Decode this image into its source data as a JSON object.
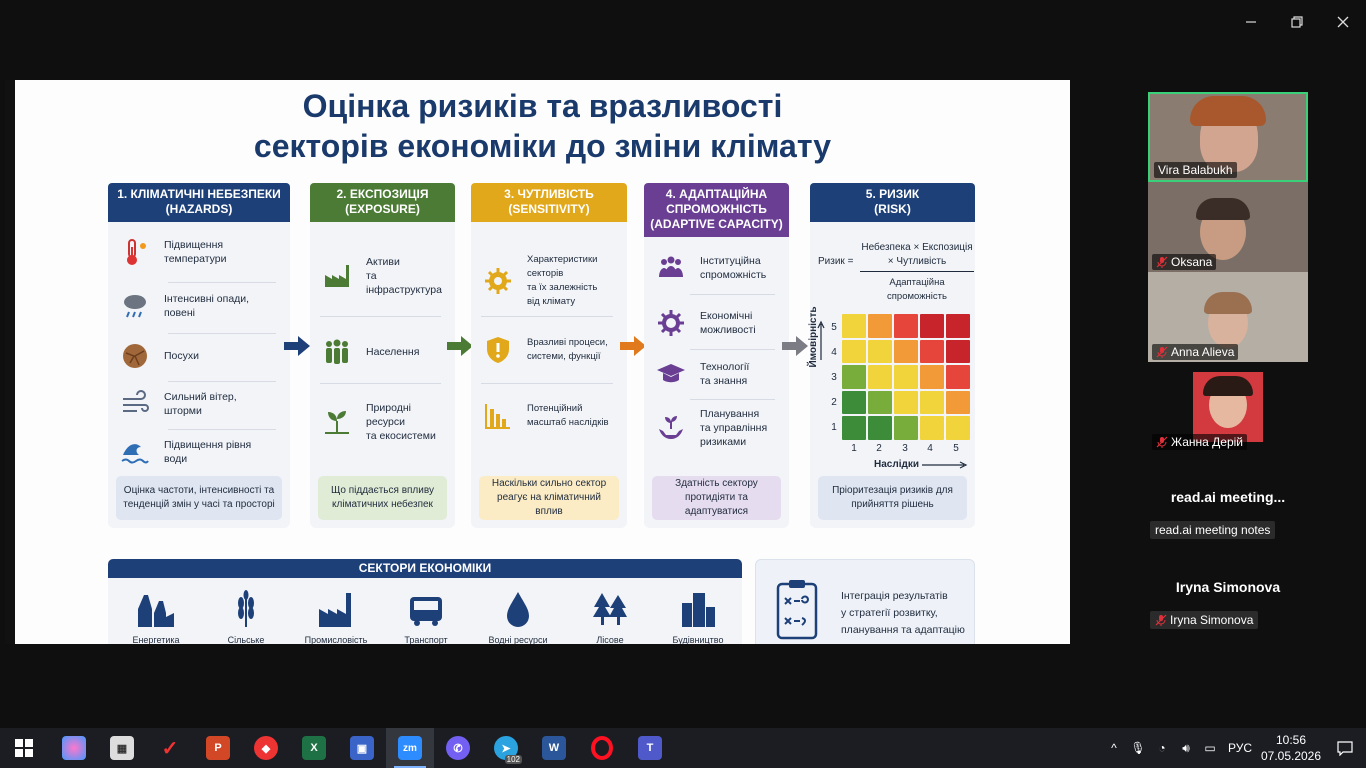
{
  "slide": {
    "title_line1": "Оцінка ризиків та вразливості",
    "title_line2": "секторів економіки до зміни клімату",
    "columns": [
      {
        "head1": "1. КЛІМАТИЧНІ НЕБЕЗПЕКИ",
        "head2": "(HAZARDS)",
        "color": "#1e4079",
        "items": [
          [
            "Підвищення",
            "температури"
          ],
          [
            "Інтенсивні опади,",
            "повені"
          ],
          [
            "Посухи",
            ""
          ],
          [
            "Сильний вітер,",
            "шторми"
          ],
          [
            "Підвищення рівня",
            "води"
          ]
        ],
        "foot": "Оцінка частоти, інтенсивності та тенденцій змін у часі та просторі",
        "footbg": "#dfe6f2"
      },
      {
        "head1": "2. ЕКСПОЗИЦІЯ",
        "head2": "(EXPOSURE)",
        "color": "#4c7b35",
        "items": [
          [
            "Активи",
            "та інфраструктура"
          ],
          [
            "Населення",
            ""
          ],
          [
            "Природні ресурси",
            "та екосистеми"
          ]
        ],
        "foot": "Що піддається впливу кліматичних небезпек",
        "footbg": "#e1ecd6"
      },
      {
        "head1": "3. ЧУТЛИВІСТЬ",
        "head2": "(SENSITIVITY)",
        "color": "#e2a81c",
        "items": [
          [
            "Характеристики секторів",
            "та їх залежність",
            "від клімату"
          ],
          [
            "Вразливі процеси,",
            "системи, функції"
          ],
          [
            "Потенційний",
            "масштаб наслідків"
          ]
        ],
        "foot": "Наскільки сильно сектор реагує на кліматичний вплив",
        "footbg": "#fbecc6"
      },
      {
        "head1": "4. АДАПТАЦІЙНА",
        "head2": "СПРОМОЖНІСТЬ",
        "head3": "(ADAPTIVE CAPACITY)",
        "color": "#6a3f93",
        "items": [
          [
            "Інституційна",
            "спроможність"
          ],
          [
            "Економічні",
            "можливості"
          ],
          [
            "Технології",
            "та знання"
          ],
          [
            "Планування",
            "та управління",
            "ризиками"
          ]
        ],
        "foot": "Здатність сектору протидіяти та адаптуватися",
        "footbg": "#e6dcef"
      },
      {
        "head1": "5. РИЗИК",
        "head2": "(RISK)",
        "color": "#1e4079",
        "foot": "Пріоритезація ризиків для прийняття рішень",
        "footbg": "#dfe6f2"
      }
    ],
    "risk": {
      "label": "Ризик =",
      "numerator1": "Небезпека × Експозиція",
      "numerator2": "× Чутливість",
      "denominator": "Адаптаційна спроможність",
      "ylabel": "Ймовірність",
      "xlabel": "Наслідки",
      "ticks": [
        "1",
        "2",
        "3",
        "4",
        "5"
      ]
    },
    "sectors_title": "СЕКТОРИ ЕКОНОМІКИ",
    "sectors": [
      "Енергетика",
      "Сільське",
      "Промисловість",
      "Транспорт",
      "Водні ресурси",
      "Лісове",
      "Будівництво"
    ],
    "integration": [
      "Інтеграція результатів",
      "у стратегії розвитку,",
      "планування та адаптацію"
    ]
  },
  "participants": [
    {
      "name": "Vira Balabukh",
      "active": true
    },
    {
      "name": "Oksana",
      "muted": true
    },
    {
      "name": "Anna Alieva",
      "muted": true
    },
    {
      "name": "Жанна Дерій",
      "muted": true
    }
  ],
  "readai": {
    "title": "read.ai  meeting...",
    "label": "read.ai meeting notes"
  },
  "iryna": {
    "title": "Iryna Simonova",
    "label": "Iryna Simonova"
  },
  "taskbar": {
    "apps": [
      "Paint",
      "Калькулятор",
      "Vivaldi",
      "PowerPoint",
      "Anydesk",
      "Excel",
      "Save",
      "Zoom",
      "Viber",
      "Telegram",
      "Word",
      "Opera",
      "Teams"
    ],
    "telegram_badge": "102",
    "lang": "РУС",
    "time": "10:56",
    "date": "07.05.2026"
  }
}
